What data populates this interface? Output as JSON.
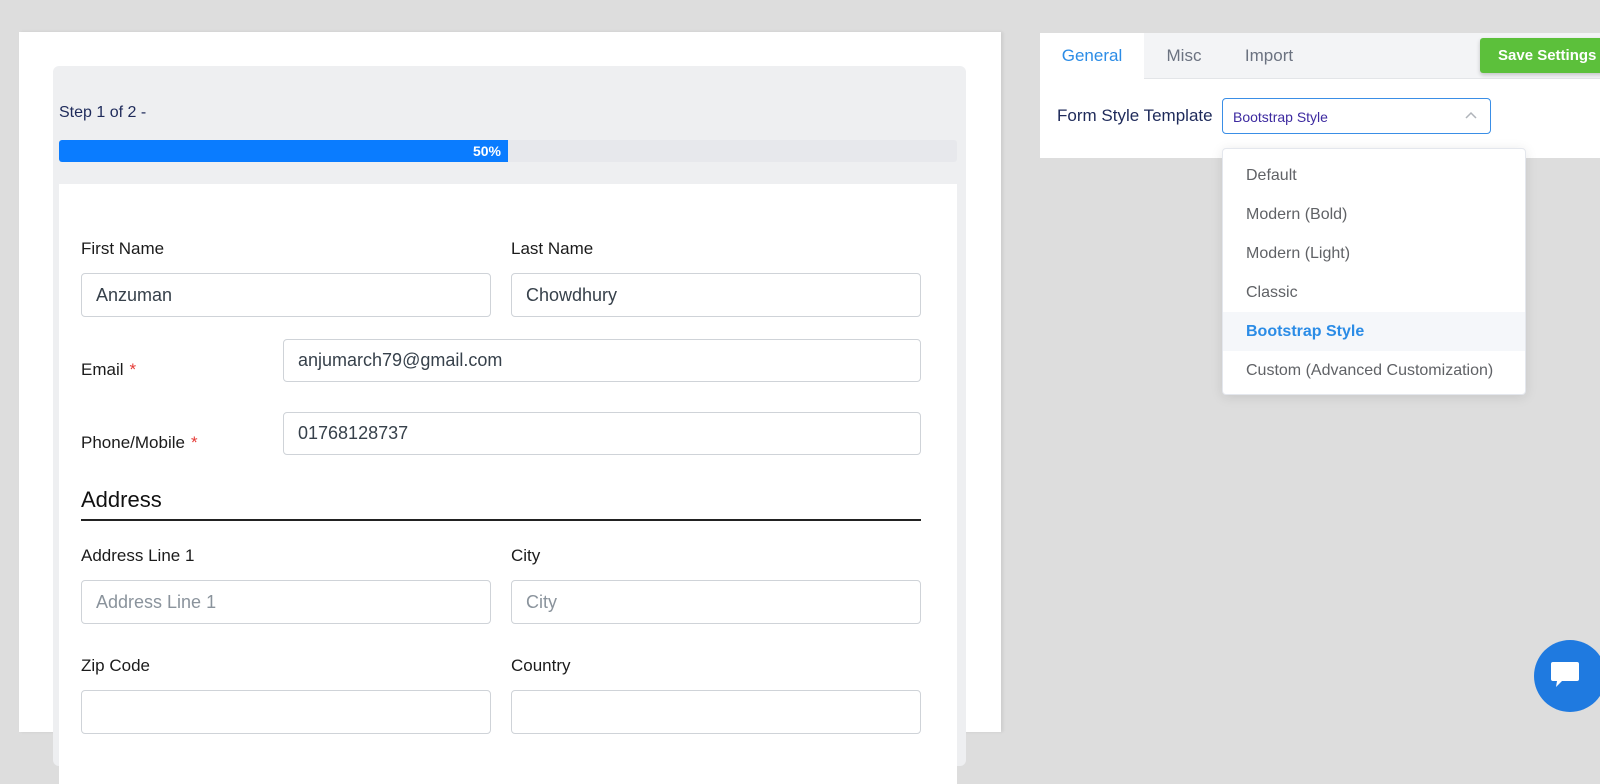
{
  "preview": {
    "step_text": "Step 1 of 2 -",
    "progress": {
      "value": 0.5,
      "label": "50%"
    },
    "fields": {
      "first_name": {
        "label": "First Name",
        "value": "Anzuman"
      },
      "last_name": {
        "label": "Last Name",
        "value": "Chowdhury"
      },
      "email": {
        "label": "Email",
        "required_mark": "*",
        "value": "anjumarch79@gmail.com"
      },
      "phone": {
        "label": "Phone/Mobile",
        "required_mark": "*",
        "value": "01768128737"
      }
    },
    "address": {
      "title": "Address",
      "line1": {
        "label": "Address Line 1",
        "placeholder": "Address Line 1"
      },
      "city": {
        "label": "City",
        "placeholder": "City"
      },
      "zip": {
        "label": "Zip Code"
      },
      "country": {
        "label": "Country"
      }
    }
  },
  "settings": {
    "tabs": [
      {
        "label": "General",
        "active": true
      },
      {
        "label": "Misc",
        "active": false
      },
      {
        "label": "Import",
        "active": false
      }
    ],
    "save_label": "Save Settings",
    "form_style_label": "Form Style Template",
    "selected_style": "Bootstrap Style",
    "style_options": [
      "Default",
      "Modern (Bold)",
      "Modern (Light)",
      "Classic",
      "Bootstrap Style",
      "Custom (Advanced Customization)"
    ]
  },
  "colors": {
    "accent": "#2b8ce6",
    "progress": "#0a7cff",
    "save_button": "#5cc03b",
    "chat_button": "#1f7ae0"
  },
  "icons": [
    "chevron-up-icon",
    "chat-icon"
  ]
}
